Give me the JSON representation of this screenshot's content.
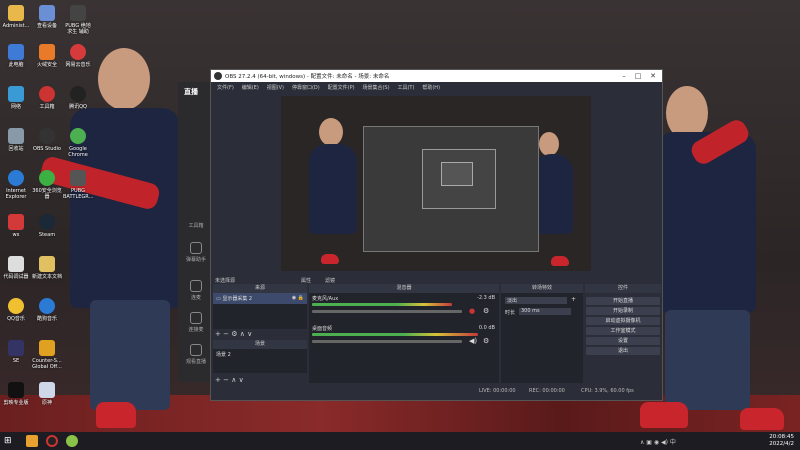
{
  "desktop": {
    "icons": [
      {
        "label": "Administ...",
        "color": "#e8b84a"
      },
      {
        "label": "查看设备",
        "color": "#6a8fd4"
      },
      {
        "label": "PUBG 绝地求生 辅助",
        "color": "#444444"
      },
      {
        "label": "此电脑",
        "color": "#3d7bd6"
      },
      {
        "label": "火绒安全",
        "color": "#e87a2a"
      },
      {
        "label": "网易云音乐",
        "color": "#d63a3a"
      },
      {
        "label": "网络",
        "color": "#3a9ad6"
      },
      {
        "label": "工具箱",
        "color": "#cc3333"
      },
      {
        "label": "腾讯QQ",
        "color": "#222222"
      },
      {
        "label": "回收站",
        "color": "#8899aa"
      },
      {
        "label": "OBS Studio",
        "color": "#333333"
      },
      {
        "label": "Google Chrome",
        "color": "#4caf50"
      },
      {
        "label": "Internet Explorer",
        "color": "#2b7bd6"
      },
      {
        "label": "360安全浏览器",
        "color": "#3cb043"
      },
      {
        "label": "PUBG BATTLEGR...",
        "color": "#555555"
      },
      {
        "label": "wx",
        "color": "#d23a3a"
      },
      {
        "label": "Steam",
        "color": "#1b2838"
      },
      {
        "label": "代码调试器",
        "color": "#dddddd"
      },
      {
        "label": "新建文本文档",
        "color": "#e0c060"
      },
      {
        "label": "QQ音乐",
        "color": "#f0c030"
      },
      {
        "label": "酷狗音乐",
        "color": "#2a7ad6"
      },
      {
        "label": "SE",
        "color": "#333366"
      },
      {
        "label": "Counter-S... Global Off...",
        "color": "#e0a020"
      },
      {
        "label": "剪映专业版",
        "color": "#111111"
      },
      {
        "label": "原神",
        "color": "#cfd8e8"
      }
    ]
  },
  "bg_app": {
    "title": "直播",
    "nav": [
      "工具箱",
      "弹幕助手",
      "连麦",
      "连接麦",
      "观看直播"
    ]
  },
  "obs": {
    "title": "OBS 27.2.4 (64-bit, windows) - 配置文件: 未命名 - 场景: 未命名",
    "menu": [
      "文件(F)",
      "编辑(E)",
      "视图(V)",
      "停靠窗口(D)",
      "配置文件(P)",
      "场景集合(S)",
      "工具(T)",
      "帮助(H)"
    ],
    "toolbar": {
      "props": "属性",
      "filter": "滤镜",
      "no_source": "未选择源"
    },
    "panels": {
      "sources_title": "来源",
      "mixer_title": "混音器",
      "transitions_title": "转场特效",
      "controls_title": "控件",
      "scenes_title": "场景"
    },
    "sources": [
      {
        "name": "显示器采集 2"
      }
    ],
    "scenes": [
      {
        "name": "场景 2"
      }
    ],
    "mixer": [
      {
        "name": "麦克风/Aux",
        "db": "-2.3 dB",
        "level": 0.78
      },
      {
        "name": "桌面音频",
        "db": "0.0 dB",
        "level": 0.92
      }
    ],
    "transitions": {
      "type": "淡出",
      "duration_label": "时长",
      "duration": "300 ms"
    },
    "controls": [
      "开始直播",
      "开始录制",
      "启动虚拟摄像机",
      "工作室模式",
      "设置",
      "退出"
    ],
    "status": {
      "live": "LIVE: 00:00:00",
      "rec": "REC: 00:00:00",
      "cpu": "CPU: 3.9%, 60.00 fps"
    }
  },
  "taskbar": {
    "clock_time": "20:08:45",
    "clock_date": "2022/4/2"
  }
}
